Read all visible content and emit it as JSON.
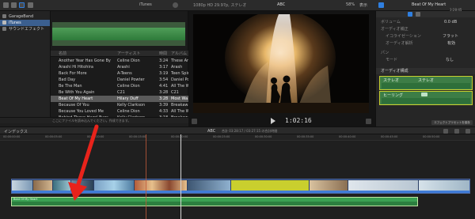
{
  "toolbar": {
    "library_menu": "iTunes",
    "viewer_format": "1080p HD 29.97p, ステレオ",
    "viewer_title": "ABC",
    "zoom": "58%",
    "view_menu": "表示",
    "inspector_title": "Beat Of My Heart",
    "inspector_time": "3:28:45"
  },
  "sidebar": {
    "items": [
      {
        "label": "GarageBand"
      },
      {
        "label": "iTunes"
      },
      {
        "label": "サウンドエフェクト"
      }
    ]
  },
  "music_table": {
    "columns": [
      "名前",
      "アーティスト",
      "時間",
      "アルバム"
    ],
    "rows": [
      {
        "name": "Another Year Has Gone By",
        "artist": "Celine Dion",
        "time": "3:24",
        "album": "These Are..."
      },
      {
        "name": "Arashi Hi Hitohira",
        "artist": "Arashi",
        "time": "3:17",
        "album": "Arash"
      },
      {
        "name": "Back For More",
        "artist": "A-Teens",
        "time": "3:19",
        "album": "Teen Spir"
      },
      {
        "name": "Bad Day",
        "artist": "Daniel Powter",
        "time": "3:54",
        "album": "Daniel Po"
      },
      {
        "name": "Be The Man",
        "artist": "Celine Dion",
        "time": "4:41",
        "album": "All The W"
      },
      {
        "name": "Be With You Again",
        "artist": "C21",
        "time": "3:28",
        "album": "C21"
      },
      {
        "name": "Beat Of My Heart",
        "artist": "Hilary Duff",
        "time": "3:28",
        "album": "Most Wa"
      },
      {
        "name": "Because Of You",
        "artist": "Kelly Clarkson",
        "time": "3:39",
        "album": "Breakawa"
      },
      {
        "name": "Because You Loved Me",
        "artist": "Celine Dion",
        "time": "4:33",
        "album": "All The W"
      },
      {
        "name": "Behind These Hazel Eyes",
        "artist": "Kelly Clarkson",
        "time": "3:18",
        "album": "Breakawa"
      }
    ],
    "footer": "ここにファイルを読み込んでください。作成できます。"
  },
  "viewer": {
    "timecode": "1:02:16"
  },
  "inspector": {
    "fields": [
      {
        "label": "ボリューム",
        "value": "0.0 dB"
      },
      {
        "label": "オーディオ補正",
        "value": ""
      },
      {
        "label": "イコライゼーション",
        "value": "フラット"
      },
      {
        "label": "オーディオ解析",
        "value": "有効"
      },
      {
        "label": "パン",
        "value": ""
      },
      {
        "label": "モード",
        "value": "なし"
      }
    ],
    "config_title": "オーディオ構成",
    "channel_1": "ステレオ",
    "channel_2": "ヒーリング",
    "stereo_mode": "ステレオ",
    "save_button": "エフェクトプリセットを保存"
  },
  "timeline": {
    "index_label": "インデックス",
    "project": "ABC",
    "duration": "合計 03:28:17 / 03:27:15 の合計時間",
    "ruler": [
      "00:00:00:00",
      "00:00:05:00",
      "00:00:10:00",
      "00:00:15:00",
      "00:00:20:00",
      "00:00:25:00",
      "00:00:30:00",
      "00:00:35:00",
      "00:00:40:00",
      "00:00:45:00",
      "00:00:50:00"
    ],
    "audio_clip_label": "Beat Of My Heart"
  },
  "colors": {
    "accent_blue": "#2f7fe0",
    "audio_green": "#3aa052",
    "selection_yellow": "#c9cf2e",
    "annotation_red": "#e8231b",
    "playhead": "#d8d8d8"
  }
}
